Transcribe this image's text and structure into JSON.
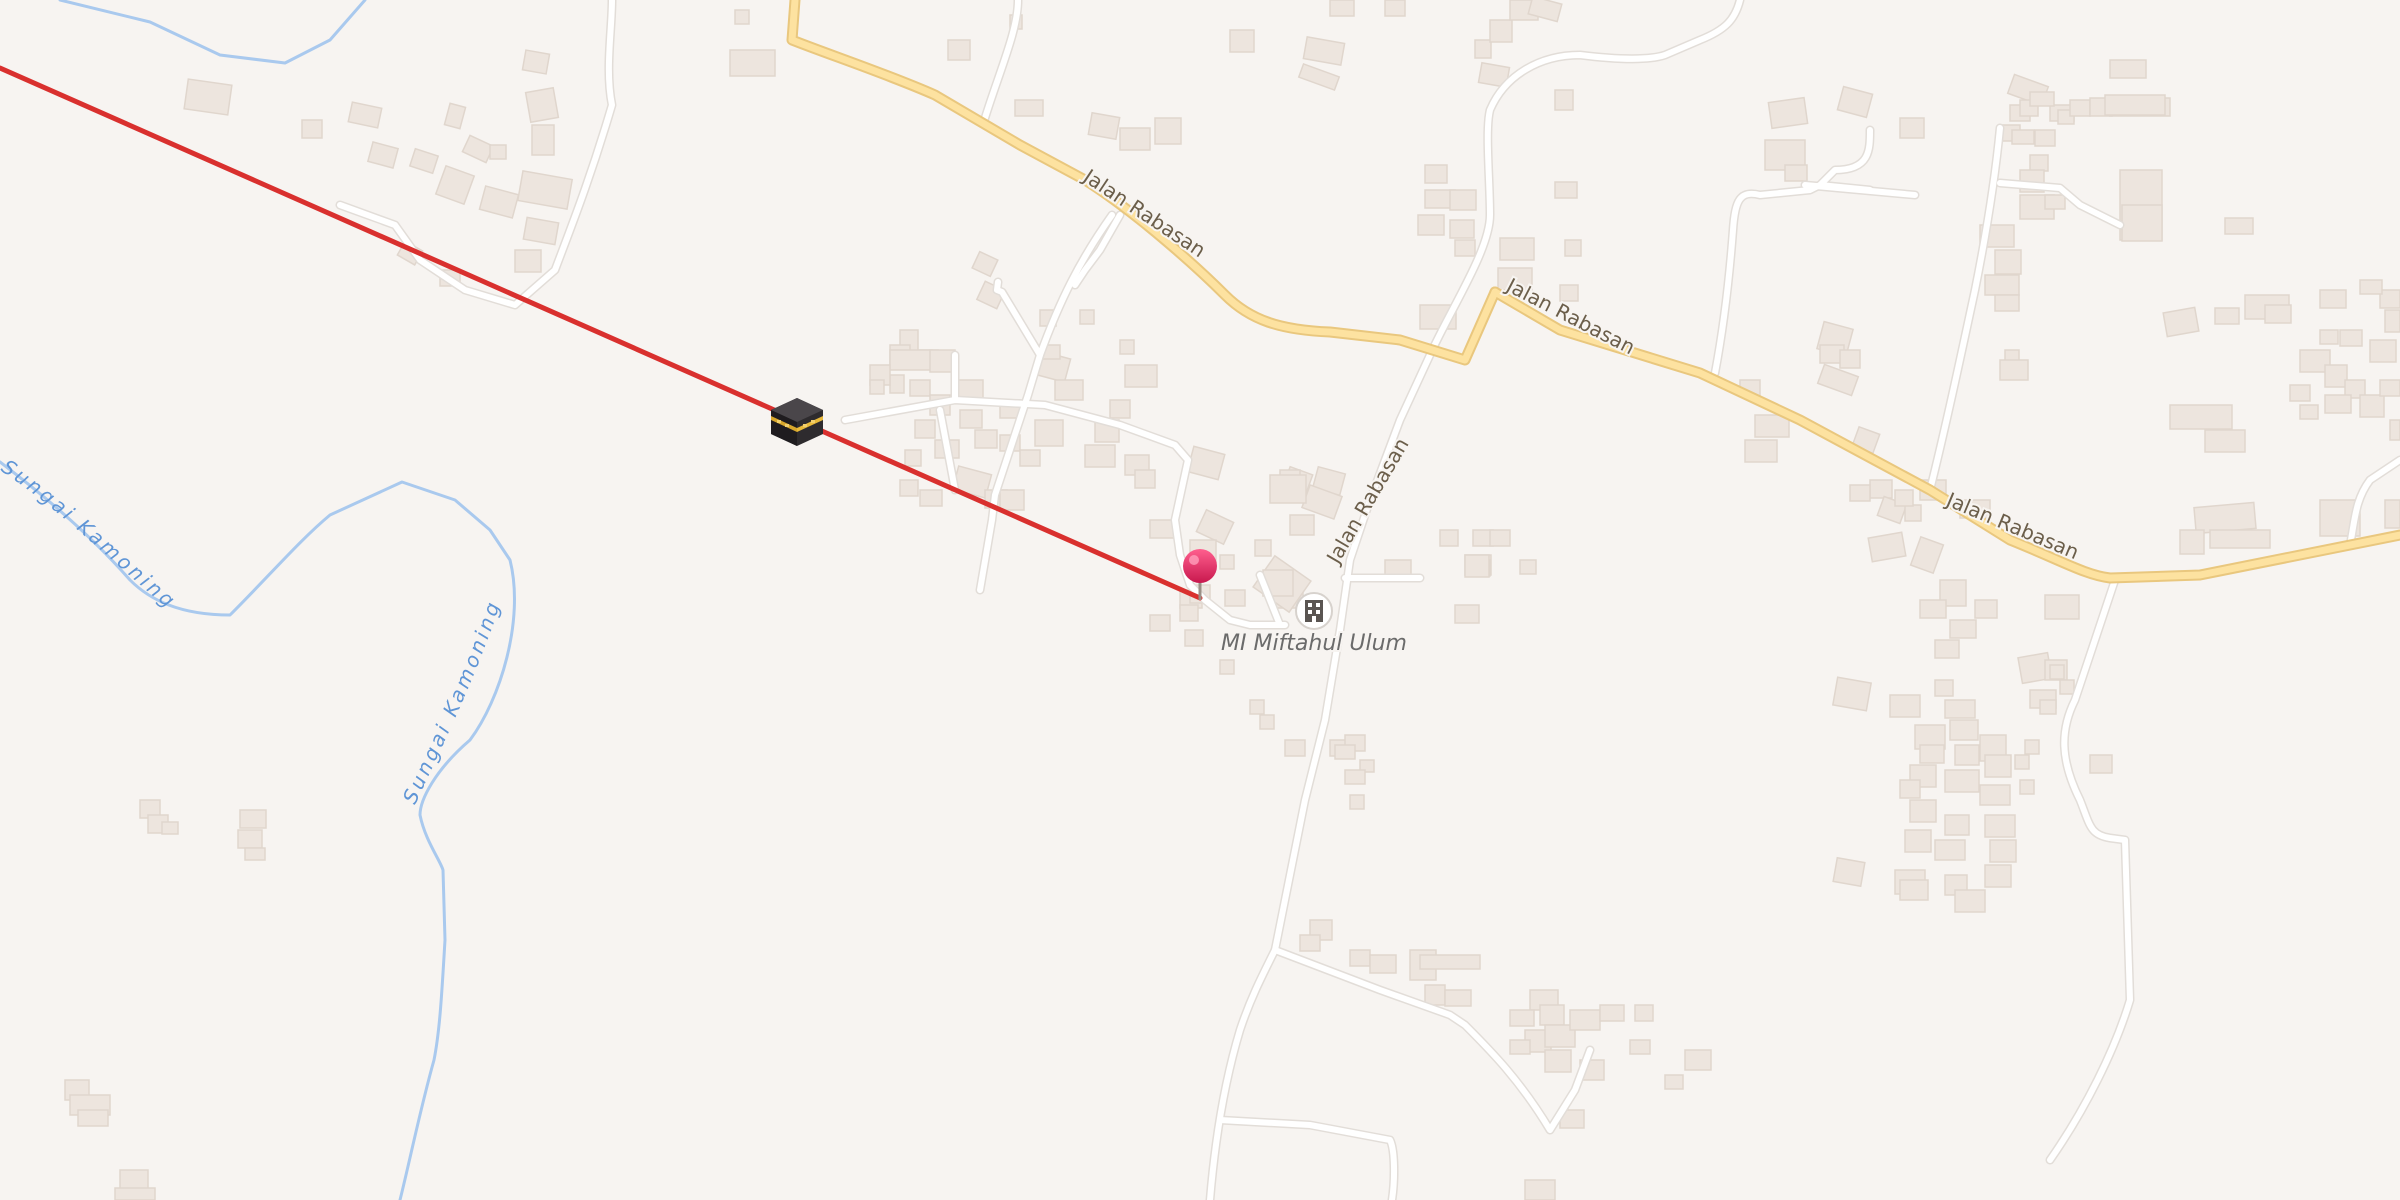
{
  "map": {
    "colors": {
      "background": "#f7f4f1",
      "building": "#ede5de",
      "building_edge": "#e0d6cd",
      "minor_road": "#ffffff",
      "minor_road_casing": "#e2ddd8",
      "major_road_fill": "#fde2a0",
      "major_road_casing": "#e9c77e",
      "river": "#a9c9ee",
      "qibla_line": "#d9302e",
      "pin": "#e8336a",
      "label_road": "#6b5e4a",
      "label_river": "#5f95d6",
      "label_poi": "#6b6b6b"
    },
    "labels": {
      "road_1": "Jalan Rabasan",
      "road_2": "Jalan Rabasan",
      "road_3": "Jalan Rabasan",
      "road_4": "Jalan Rabasan",
      "river_1": "Sungai Kamoning",
      "river_2": "Sungai Kamoning",
      "poi": "MI Miftahul Ulum"
    },
    "icons": {
      "qibla_marker": "kaaba-icon",
      "location_pin": "pin-icon",
      "school": "school-icon"
    }
  }
}
